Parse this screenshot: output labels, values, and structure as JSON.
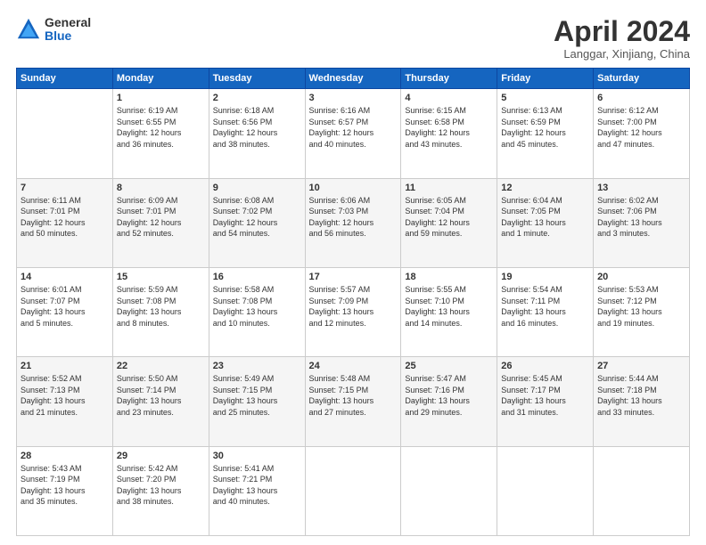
{
  "logo": {
    "general": "General",
    "blue": "Blue"
  },
  "title": "April 2024",
  "location": "Langgar, Xinjiang, China",
  "days": [
    "Sunday",
    "Monday",
    "Tuesday",
    "Wednesday",
    "Thursday",
    "Friday",
    "Saturday"
  ],
  "weeks": [
    [
      {
        "day": "",
        "content": ""
      },
      {
        "day": "1",
        "content": "Sunrise: 6:19 AM\nSunset: 6:55 PM\nDaylight: 12 hours\nand 36 minutes."
      },
      {
        "day": "2",
        "content": "Sunrise: 6:18 AM\nSunset: 6:56 PM\nDaylight: 12 hours\nand 38 minutes."
      },
      {
        "day": "3",
        "content": "Sunrise: 6:16 AM\nSunset: 6:57 PM\nDaylight: 12 hours\nand 40 minutes."
      },
      {
        "day": "4",
        "content": "Sunrise: 6:15 AM\nSunset: 6:58 PM\nDaylight: 12 hours\nand 43 minutes."
      },
      {
        "day": "5",
        "content": "Sunrise: 6:13 AM\nSunset: 6:59 PM\nDaylight: 12 hours\nand 45 minutes."
      },
      {
        "day": "6",
        "content": "Sunrise: 6:12 AM\nSunset: 7:00 PM\nDaylight: 12 hours\nand 47 minutes."
      }
    ],
    [
      {
        "day": "7",
        "content": "Sunrise: 6:11 AM\nSunset: 7:01 PM\nDaylight: 12 hours\nand 50 minutes."
      },
      {
        "day": "8",
        "content": "Sunrise: 6:09 AM\nSunset: 7:01 PM\nDaylight: 12 hours\nand 52 minutes."
      },
      {
        "day": "9",
        "content": "Sunrise: 6:08 AM\nSunset: 7:02 PM\nDaylight: 12 hours\nand 54 minutes."
      },
      {
        "day": "10",
        "content": "Sunrise: 6:06 AM\nSunset: 7:03 PM\nDaylight: 12 hours\nand 56 minutes."
      },
      {
        "day": "11",
        "content": "Sunrise: 6:05 AM\nSunset: 7:04 PM\nDaylight: 12 hours\nand 59 minutes."
      },
      {
        "day": "12",
        "content": "Sunrise: 6:04 AM\nSunset: 7:05 PM\nDaylight: 13 hours\nand 1 minute."
      },
      {
        "day": "13",
        "content": "Sunrise: 6:02 AM\nSunset: 7:06 PM\nDaylight: 13 hours\nand 3 minutes."
      }
    ],
    [
      {
        "day": "14",
        "content": "Sunrise: 6:01 AM\nSunset: 7:07 PM\nDaylight: 13 hours\nand 5 minutes."
      },
      {
        "day": "15",
        "content": "Sunrise: 5:59 AM\nSunset: 7:08 PM\nDaylight: 13 hours\nand 8 minutes."
      },
      {
        "day": "16",
        "content": "Sunrise: 5:58 AM\nSunset: 7:08 PM\nDaylight: 13 hours\nand 10 minutes."
      },
      {
        "day": "17",
        "content": "Sunrise: 5:57 AM\nSunset: 7:09 PM\nDaylight: 13 hours\nand 12 minutes."
      },
      {
        "day": "18",
        "content": "Sunrise: 5:55 AM\nSunset: 7:10 PM\nDaylight: 13 hours\nand 14 minutes."
      },
      {
        "day": "19",
        "content": "Sunrise: 5:54 AM\nSunset: 7:11 PM\nDaylight: 13 hours\nand 16 minutes."
      },
      {
        "day": "20",
        "content": "Sunrise: 5:53 AM\nSunset: 7:12 PM\nDaylight: 13 hours\nand 19 minutes."
      }
    ],
    [
      {
        "day": "21",
        "content": "Sunrise: 5:52 AM\nSunset: 7:13 PM\nDaylight: 13 hours\nand 21 minutes."
      },
      {
        "day": "22",
        "content": "Sunrise: 5:50 AM\nSunset: 7:14 PM\nDaylight: 13 hours\nand 23 minutes."
      },
      {
        "day": "23",
        "content": "Sunrise: 5:49 AM\nSunset: 7:15 PM\nDaylight: 13 hours\nand 25 minutes."
      },
      {
        "day": "24",
        "content": "Sunrise: 5:48 AM\nSunset: 7:15 PM\nDaylight: 13 hours\nand 27 minutes."
      },
      {
        "day": "25",
        "content": "Sunrise: 5:47 AM\nSunset: 7:16 PM\nDaylight: 13 hours\nand 29 minutes."
      },
      {
        "day": "26",
        "content": "Sunrise: 5:45 AM\nSunset: 7:17 PM\nDaylight: 13 hours\nand 31 minutes."
      },
      {
        "day": "27",
        "content": "Sunrise: 5:44 AM\nSunset: 7:18 PM\nDaylight: 13 hours\nand 33 minutes."
      }
    ],
    [
      {
        "day": "28",
        "content": "Sunrise: 5:43 AM\nSunset: 7:19 PM\nDaylight: 13 hours\nand 35 minutes."
      },
      {
        "day": "29",
        "content": "Sunrise: 5:42 AM\nSunset: 7:20 PM\nDaylight: 13 hours\nand 38 minutes."
      },
      {
        "day": "30",
        "content": "Sunrise: 5:41 AM\nSunset: 7:21 PM\nDaylight: 13 hours\nand 40 minutes."
      },
      {
        "day": "",
        "content": ""
      },
      {
        "day": "",
        "content": ""
      },
      {
        "day": "",
        "content": ""
      },
      {
        "day": "",
        "content": ""
      }
    ]
  ]
}
